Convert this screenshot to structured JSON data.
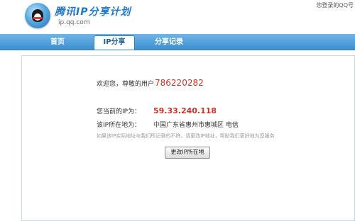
{
  "header": {
    "brand_title": "腾讯IP分享计划",
    "brand_url": "ip.qq.com",
    "login_hint": "您登录的QQ号"
  },
  "nav": {
    "home": "首页",
    "ip_share": "IP分享",
    "share_record": "分享记录",
    "active": "IP分享"
  },
  "main": {
    "welcome_text": "欢迎您，尊敬的用户",
    "user_id": "786220282",
    "current_ip_label": "您当前的IP为：",
    "current_ip": "59.33.240.118",
    "location_label": "该IP所在地为：",
    "location": "中国广东省惠州市惠城区  电信",
    "note": "如果该IP实际地址与我们所记录的不符，请更改IP地址，帮助我们更好地为您服务",
    "change_button": "更改IP所在地"
  },
  "colors": {
    "brand_blue": "#1f77c9",
    "nav_blue": "#3d8fd1",
    "highlight_red": "#c0392b"
  },
  "icons": {
    "logo": "qq-penguin-logo-icon"
  }
}
